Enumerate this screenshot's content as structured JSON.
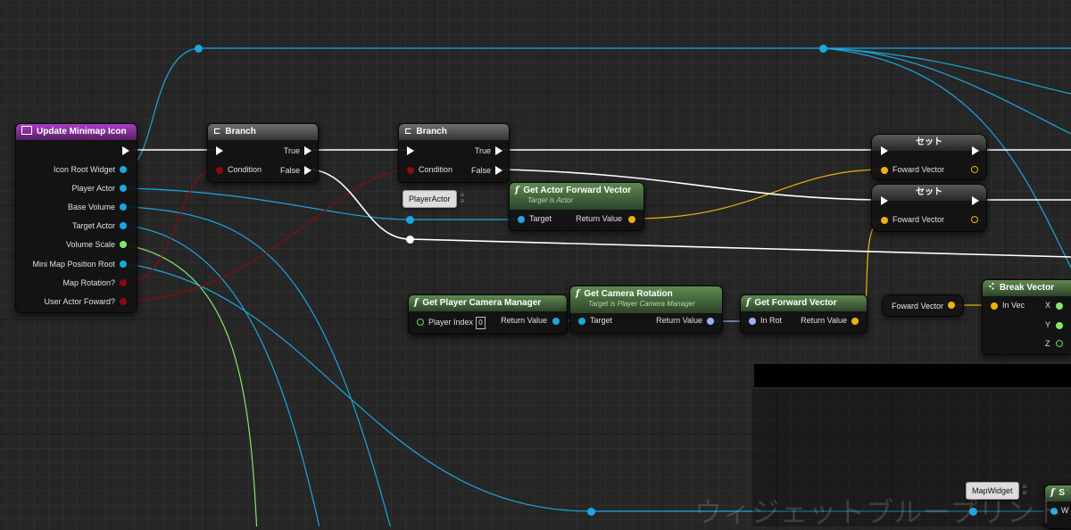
{
  "watermark": "ウィジェットブループリント",
  "colors": {
    "object_pin": "#1aa7e0",
    "bool_pin": "#8a0c0c",
    "float_pin": "#82e86a",
    "vector_pin": "#f0b010",
    "rotator_pin": "#9ab1f7",
    "exec_pin": "#ffffff",
    "event_header": "#9b3bb8",
    "function_header": "#4f7a44"
  },
  "nodes": {
    "update_minimap": {
      "title": "Update Minimap Icon",
      "icon": "event-icon",
      "outputs": [
        "Icon Root Widget",
        "Player Actor",
        "Base Volume",
        "Target Actor",
        "Volume Scale",
        "Mini Map Position Root",
        "Map Rotation?",
        "User Actor Foward?"
      ]
    },
    "branch1": {
      "title": "Branch",
      "icon": "branch-icon",
      "condition": "Condition",
      "true_label": "True",
      "false_label": "False"
    },
    "branch2": {
      "title": "Branch",
      "icon": "branch-icon",
      "condition": "Condition",
      "true_label": "True",
      "false_label": "False"
    },
    "get_actor_forward": {
      "title": "Get Actor Forward Vector",
      "subtitle": "Target is Actor",
      "target": "Target",
      "return": "Return Value"
    },
    "set1": {
      "title": "セット",
      "input": "Foward Vector"
    },
    "set2": {
      "title": "セット",
      "input": "Foward Vector"
    },
    "get_player_camera": {
      "title": "Get Player Camera Manager",
      "player_index": "Player Index",
      "player_index_value": "0",
      "return": "Return Value"
    },
    "get_camera_rotation": {
      "title": "Get Camera Rotation",
      "subtitle": "Target is Player Camera Manager",
      "target": "Target",
      "return": "Return Value"
    },
    "get_forward_vector": {
      "title": "Get Forward Vector",
      "in_rot": "In Rot",
      "return": "Return Value"
    },
    "foward_var": {
      "label": "Foward Vector"
    },
    "break_vector": {
      "title": "Break Vector",
      "in_vec": "In Vec",
      "x": "X",
      "y": "Y",
      "z": "Z"
    }
  },
  "comments": {
    "player_actor": "PlayerActor",
    "map_widget": "MapWidget"
  },
  "partial_node": {
    "title_fragment": "S",
    "pin_fragment": "W"
  }
}
